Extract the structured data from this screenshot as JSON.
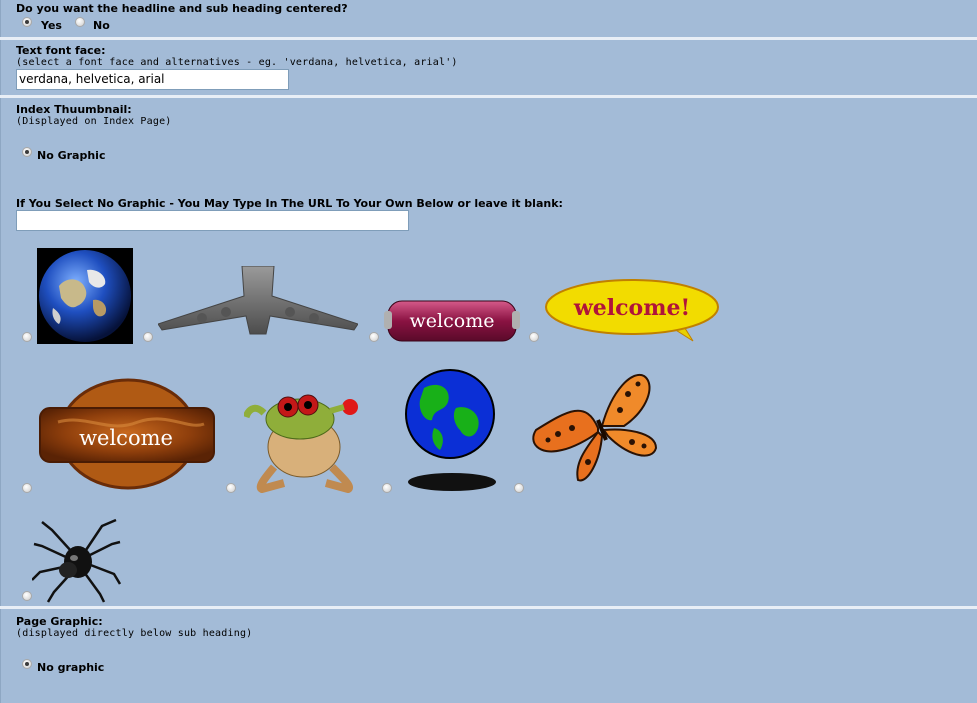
{
  "centered": {
    "question": "Do you want the headline and sub heading centered?",
    "options": [
      "Yes",
      "No"
    ],
    "selected": "Yes"
  },
  "font_face": {
    "label": "Text font face:",
    "hint": "(select a font face and alternatives - eg. 'verdana, helvetica, arial')",
    "value": "verdana, helvetica, arial"
  },
  "index_thumbnail": {
    "label": "Index Thuumbnail:",
    "hint": "(Displayed on Index Page)",
    "no_graphic_label": "No Graphic",
    "url_prompt": "If You Select No Graphic - You May Type In The URL To Your Own Below or leave it blank:",
    "url_value": "",
    "graphics": [
      {
        "icon": "earth-globe-image"
      },
      {
        "icon": "jet-airplane-image"
      },
      {
        "icon": "welcome-pill-button-image",
        "text": "welcome"
      },
      {
        "icon": "welcome-speech-bubble-image",
        "text": "welcome!"
      },
      {
        "icon": "welcome-wood-sign-image",
        "text": "welcome"
      },
      {
        "icon": "frog-image"
      },
      {
        "icon": "spinning-globe-image"
      },
      {
        "icon": "butterfly-image"
      },
      {
        "icon": "spider-image"
      }
    ]
  },
  "page_graphic": {
    "label": "Page Graphic:",
    "hint": "(displayed directly below sub heading)",
    "no_graphic_label": "No graphic"
  }
}
